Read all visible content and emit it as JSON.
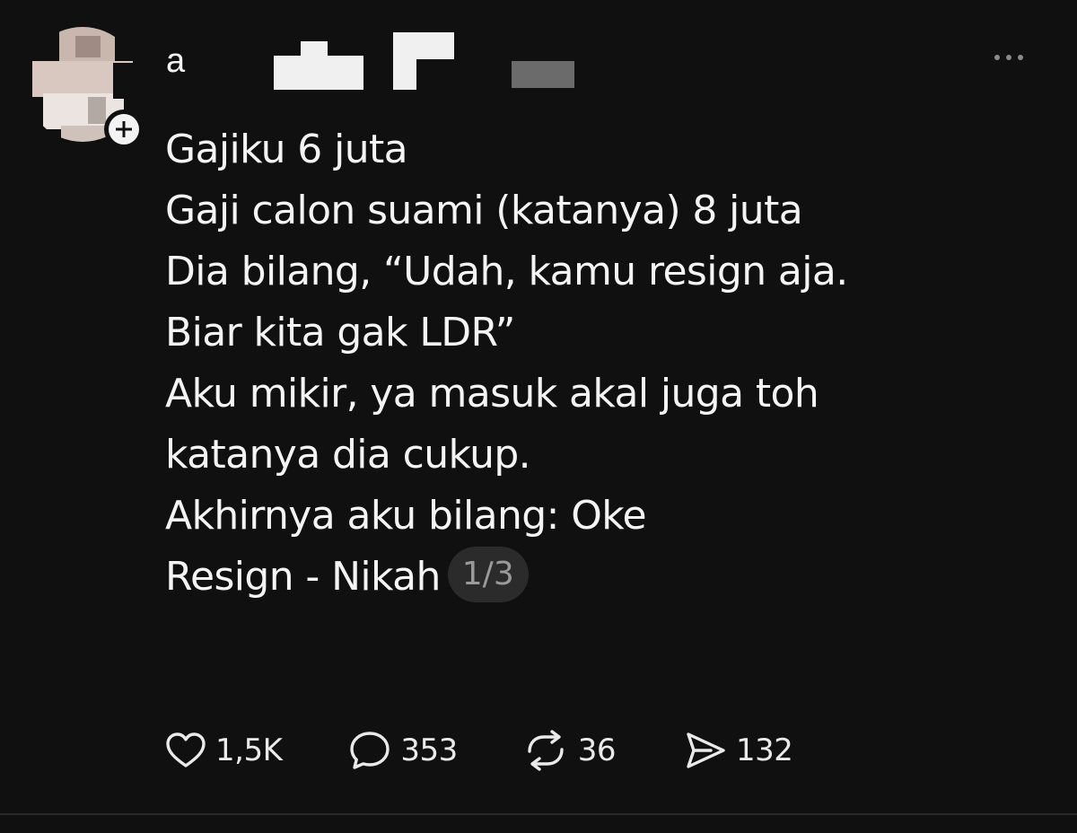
{
  "post": {
    "username_visible": "a",
    "body_lines": [
      "Gajiku 6 juta",
      "Gaji calon suami (katanya) 8 juta",
      "Dia bilang, “Udah, kamu resign aja.",
      "Biar kita gak LDR”",
      "Aku mikir, ya masuk akal juga toh",
      "katanya dia cukup.",
      "Akhirnya aku bilang: Oke",
      "Resign - Nikah"
    ],
    "page_indicator": "1/3"
  },
  "actions": {
    "likes": "1,5K",
    "replies": "353",
    "reposts": "36",
    "shares": "132"
  },
  "icons": {
    "follow": "plus-icon",
    "more": "more-horizontal-icon",
    "like": "heart-icon",
    "reply": "comment-bubble-icon",
    "repost": "repost-arrows-icon",
    "share": "send-icon"
  },
  "colors": {
    "background": "#101010",
    "text": "#f4f4f4",
    "muted": "#8a8a8a",
    "badge_bg": "#2b2b2b"
  }
}
